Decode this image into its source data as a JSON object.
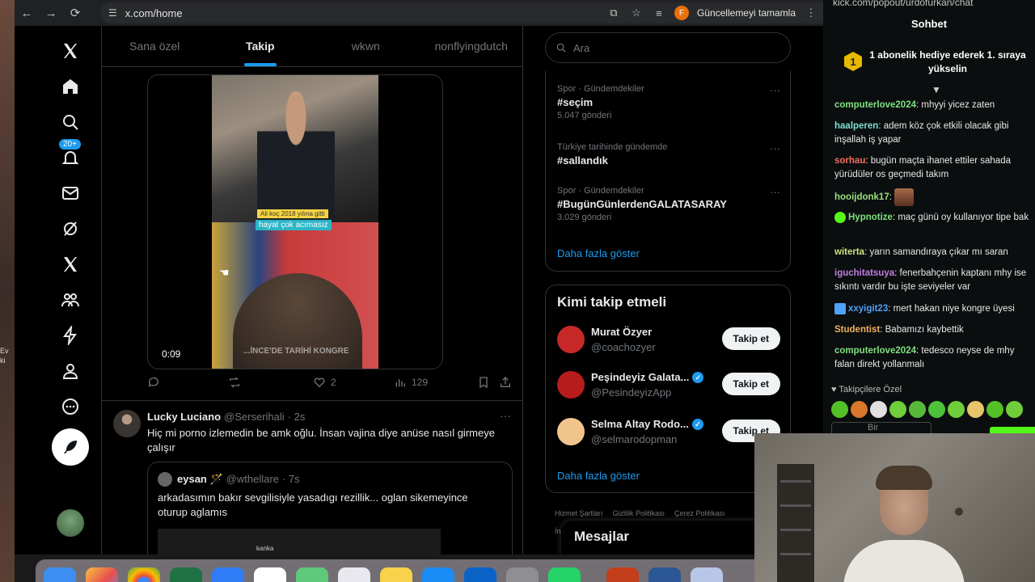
{
  "browser": {
    "url": "x.com/home",
    "profile_initial": "F",
    "update_label": "Güncellemeyi tamamla"
  },
  "desktop_left_text": "Ev\nki",
  "nav": {
    "notification_badge": "20+"
  },
  "timeline": {
    "tabs": [
      {
        "label": "Sana özel",
        "active": false
      },
      {
        "label": "Takip",
        "active": true
      },
      {
        "label": "wkwn",
        "active": false
      },
      {
        "label": "nonflyingdutch",
        "active": false
      }
    ],
    "video": {
      "caption_top": "Ali koç 2018 yılına gitti",
      "caption_main": "hayat çok acımasız",
      "caption_bottom": "...İNCE'DE TARİHİ KONGRE",
      "duration": "0:09"
    },
    "post1_actions": {
      "replies": "",
      "reposts": "",
      "likes": "2",
      "views": "129"
    },
    "post2": {
      "name": "Lucky Luciano",
      "handle": "@Serserihali",
      "time": "· 2s",
      "text": "Hiç mi porno izlemedin be amk oğlu. İnsan vajina diye anüse nasıl girmeye çalışır",
      "quote": {
        "name": "eysan 🪄",
        "handle": "@wthellare",
        "time": "· 7s",
        "text": "arkadasımın bakır sevgilisiyle yasadıgı rezillik... oglan sikemeyince oturup aglamıs",
        "image_text": "kanka"
      }
    }
  },
  "sidebar": {
    "search_placeholder": "Ara",
    "trends": [
      {
        "context": "Spor · Gündemdekiler",
        "tag": "#seçim",
        "count": "5.047 gönderi"
      },
      {
        "context": "Türkiye tarihinde gündemde",
        "tag": "#sallandık",
        "count": ""
      },
      {
        "context": "Spor · Gündemdekiler",
        "tag": "#BugünGünlerdenGALATASARAY",
        "count": "3.029 gönderi"
      }
    ],
    "show_more": "Daha fazla göster",
    "who_to_follow": {
      "title": "Kimi takip etmeli",
      "accounts": [
        {
          "name": "Murat Özyer",
          "handle": "@coachozyer",
          "verified": false,
          "color": "#c62828"
        },
        {
          "name": "Peşindeyiz Galata...",
          "handle": "@PesindeyizApp",
          "verified": true,
          "color": "#b71c1c"
        },
        {
          "name": "Selma Altay Rodo...",
          "handle": "@selmarodopman",
          "verified": true,
          "color": "#f2c48d"
        }
      ],
      "follow_label": "Takip et",
      "show_more": "Daha fazla göster"
    },
    "footer_links": [
      "Hizmet Şartları",
      "Gizlilik Politikası",
      "Çerez Politikası"
    ],
    "footer_extra": "İn",
    "messages_label": "Mesajlar"
  },
  "chat": {
    "url": "kick.com/popout/urdofurkan/chat",
    "header": "Sohbet",
    "gift_rank": "1",
    "gift_text": "1 abonelik hediye ederek 1. sıraya yükselin",
    "messages": [
      {
        "user": "computerlove2024",
        "color": "#7ee07e",
        "text": ": mhyyi yicez zaten"
      },
      {
        "user": "haalperen",
        "color": "#7ee0d0",
        "text": ": adem köz çok etkili olacak gibi inşallah iş yapar"
      },
      {
        "user": "sorhau",
        "color": "#f07060",
        "text": ": bugün maçta ihanet ettiler sahada yürüdüler os geçmedi takım"
      },
      {
        "user": "hooijdonk17",
        "color": "#9be07e",
        "text": ":"
      },
      {
        "user": "Hypnotize",
        "color": "#7ee07e",
        "text": ": maç günü oy kullanıyor tipe bak"
      },
      {
        "user": "witerta",
        "color": "#d0e07e",
        "text": ": yarın samandıraya çıkar mı saran"
      },
      {
        "user": "iguchitatsuya",
        "color": "#c07ee0",
        "text": ": fenerbahçenin kaptanı mhy ise sıkıntı vardır bu işte seviyeler var"
      },
      {
        "user": "xxyigit23",
        "color": "#4fa3f7",
        "text": ": mert hakan niye kongre üyesi"
      },
      {
        "user": "Studentist",
        "color": "#f0b060",
        "text": ": Babamızı kaybettik"
      },
      {
        "user": "computerlove2024",
        "color": "#7ee07e",
        "text": ": tedesco neyse de mhy falan direkt yollanmalı"
      }
    ],
    "subscribers_label": "Takipçilere Özel",
    "input_placeholder": "Bir"
  },
  "colors": {
    "accent": "#1d9bf0",
    "kick_green": "#53fc18"
  }
}
